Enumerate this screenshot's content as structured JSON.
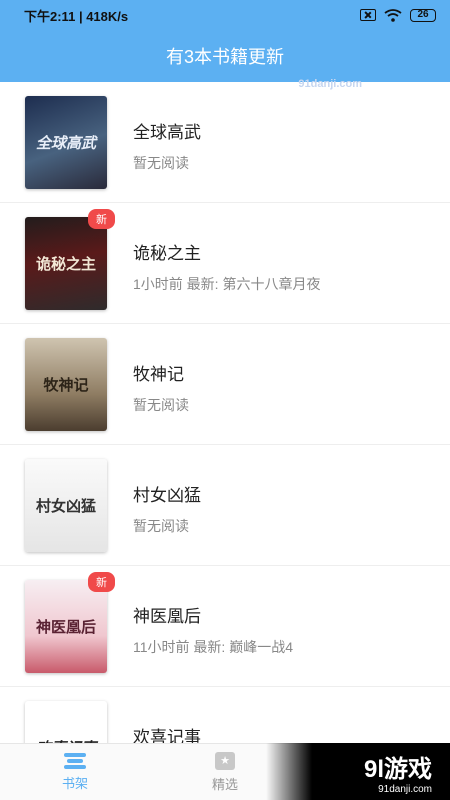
{
  "status_bar": {
    "time": "下午2:11",
    "speed": "418K/s",
    "battery": "26",
    "icons": [
      "sim-off-icon",
      "wifi-icon",
      "battery-icon"
    ]
  },
  "header": {
    "title": "有3本书籍更新"
  },
  "watermark_top": "91danji.com",
  "books": [
    {
      "title": "全球高武",
      "subtitle": "暂无阅读",
      "badge": "",
      "cover_text": "全球高武"
    },
    {
      "title": "诡秘之主",
      "subtitle": "1小时前 最新: 第六十八章月夜",
      "badge": "新",
      "cover_text": "诡秘之主"
    },
    {
      "title": "牧神记",
      "subtitle": "暂无阅读",
      "badge": "",
      "cover_text": "牧神记"
    },
    {
      "title": "村女凶猛",
      "subtitle": "暂无阅读",
      "badge": "",
      "cover_text": "村女凶猛"
    },
    {
      "title": "神医凰后",
      "subtitle": "11小时前 最新: 巅峰一战4",
      "badge": "新",
      "cover_text": "神医凰后"
    },
    {
      "title": "欢喜记事",
      "subtitle": "",
      "badge": "",
      "cover_text": "欢喜记事"
    }
  ],
  "tabbar": {
    "tabs": [
      {
        "label": "书架",
        "icon": "bookshelf-icon",
        "active": true
      },
      {
        "label": "精选",
        "icon": "featured-star-icon",
        "active": false
      }
    ]
  },
  "watermark_corner": {
    "big": "9l游戏",
    "small": "91danji.com"
  },
  "colors": {
    "accent": "#5cb0f2",
    "badge": "#f04a4a"
  }
}
